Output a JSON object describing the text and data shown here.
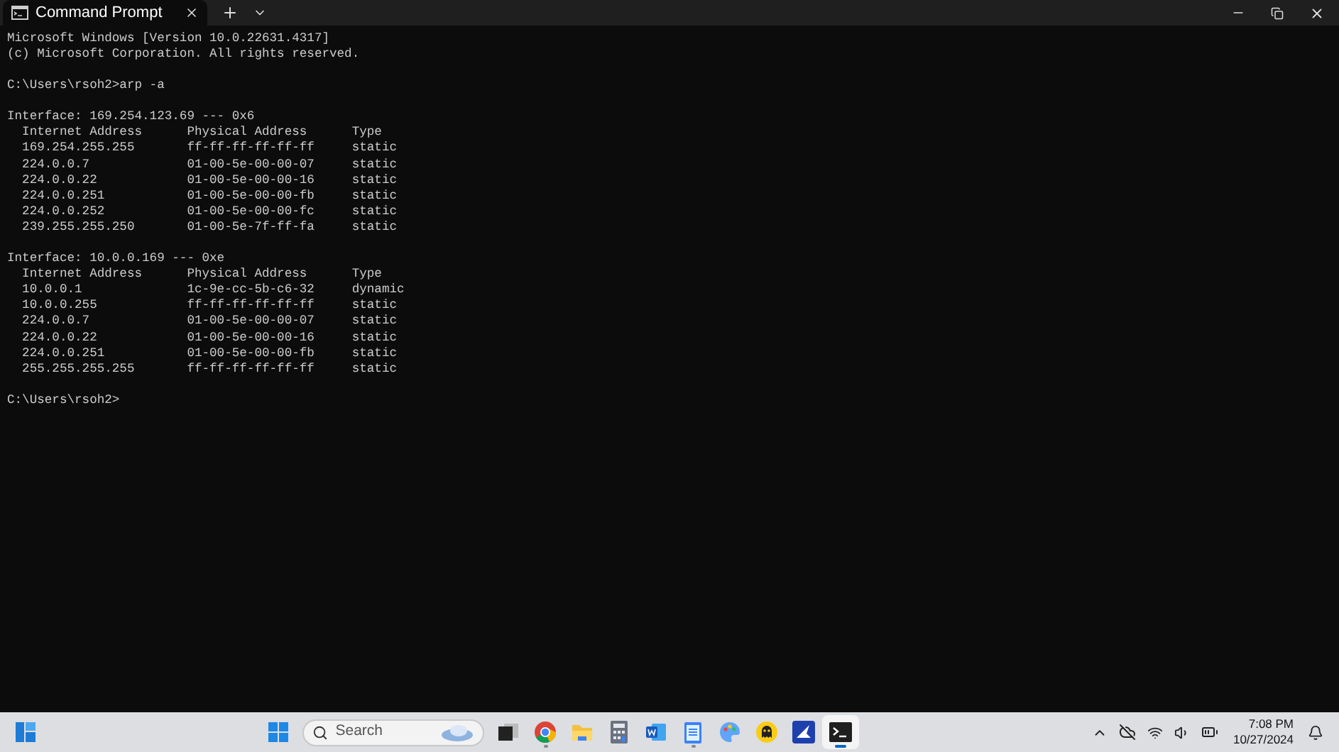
{
  "window": {
    "tab": {
      "title": "Command Prompt",
      "selected": true
    }
  },
  "terminal": {
    "blocks": [
      [
        "Microsoft Windows [Version 10.0.22631.4317]",
        "(c) Microsoft Corporation. All rights reserved."
      ],
      [
        "C:\\Users\\rsoh2>arp -a"
      ],
      [
        "Interface: 169.254.123.69 --- 0x6",
        "  Internet Address      Physical Address      Type",
        "  169.254.255.255       ff-ff-ff-ff-ff-ff     static",
        "  224.0.0.7             01-00-5e-00-00-07     static",
        "  224.0.0.22            01-00-5e-00-00-16     static",
        "  224.0.0.251           01-00-5e-00-00-fb     static",
        "  224.0.0.252           01-00-5e-00-00-fc     static",
        "  239.255.255.250       01-00-5e-7f-ff-fa     static"
      ],
      [
        "Interface: 10.0.0.169 --- 0xe",
        "  Internet Address      Physical Address      Type",
        "  10.0.0.1              1c-9e-cc-5b-c6-32     dynamic",
        "  10.0.0.255            ff-ff-ff-ff-ff-ff     static",
        "  224.0.0.7             01-00-5e-00-00-07     static",
        "  224.0.0.22            01-00-5e-00-00-16     static",
        "  224.0.0.251           01-00-5e-00-00-fb     static",
        "  255.255.255.255       ff-ff-ff-ff-ff-ff     static"
      ],
      [
        "C:\\Users\\rsoh2>"
      ]
    ]
  },
  "taskbar": {
    "search": {
      "placeholder": "Search"
    },
    "apps": [
      {
        "kind": "taskview",
        "running": false,
        "active": false
      },
      {
        "kind": "chrome",
        "running": true,
        "active": false
      },
      {
        "kind": "folder",
        "running": false,
        "active": false
      },
      {
        "kind": "calculator",
        "running": false,
        "active": false
      },
      {
        "kind": "word",
        "running": false,
        "active": false
      },
      {
        "kind": "notepad",
        "running": true,
        "active": false
      },
      {
        "kind": "paint",
        "running": false,
        "active": false
      },
      {
        "kind": "ghost",
        "running": false,
        "active": false
      },
      {
        "kind": "bird",
        "running": false,
        "active": false
      },
      {
        "kind": "terminal",
        "running": true,
        "active": true
      }
    ],
    "time": "7:08 PM",
    "date": "10/27/2024"
  }
}
